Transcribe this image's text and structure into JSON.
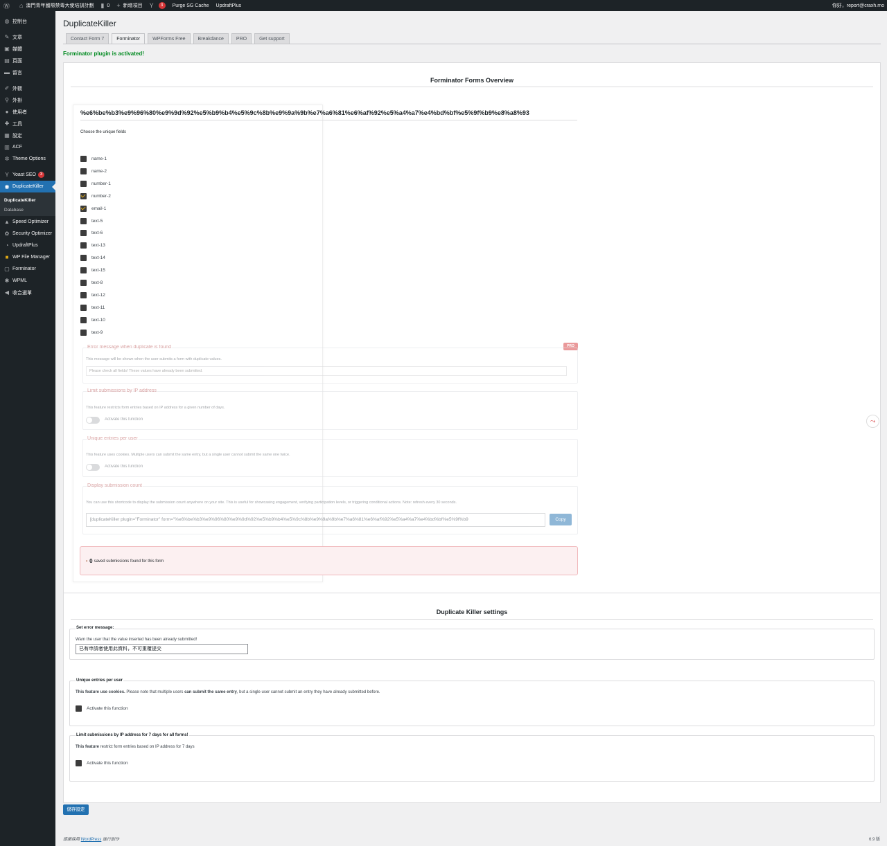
{
  "adminbar": {
    "site": "澳門青年國際禁毒大使培訓計劃",
    "comments": "0",
    "new": "新增項目",
    "yoast_count": "3",
    "purge": "Purge SG Cache",
    "updraft": "UpdraftPlus",
    "greeting": "你好，report@craxh.mo"
  },
  "menu": {
    "dashboard": "控制台",
    "posts": "文章",
    "media": "媒體",
    "pages": "頁面",
    "comments": "留言",
    "appearance": "外觀",
    "plugins": "外掛",
    "users": "使用者",
    "tools": "工具",
    "settings": "設定",
    "acf": "ACF",
    "theme_options": "Theme Options",
    "yoast": "Yoast SEO",
    "yoast_badge": "3",
    "duplicatekiller": "DuplicateKiller",
    "sub_dk": "DuplicateKiller",
    "sub_db": "Database",
    "speed": "Speed Optimizer",
    "security": "Security Optimizer",
    "updraft": "UpdraftPlus",
    "wpfm": "WP File Manager",
    "forminator": "Forminator",
    "wpml": "WPML",
    "collapse": "收合選單"
  },
  "page": {
    "title": "DuplicateKiller",
    "notice": "Forminator plugin is activated!"
  },
  "tabs": [
    "Contact Form 7",
    "Forminator",
    "WPForms Free",
    "Breakdance",
    "PRO",
    "Get support"
  ],
  "overview": {
    "title": "Forminator Forms Overview",
    "form_name": "%e6%be%b3%e9%96%80%e9%9d%92%e5%b9%b4%e5%9c%8b%e9%9a%9b%e7%a6%81%e6%af%92%e5%a4%a7%e4%bd%bf%e5%9f%b9%e8%a8%93",
    "choose_label": "Choose the unique fields",
    "fields": [
      {
        "name": "name-1",
        "checked": false
      },
      {
        "name": "name-2",
        "checked": false
      },
      {
        "name": "number-1",
        "checked": false
      },
      {
        "name": "number-2",
        "checked": true
      },
      {
        "name": "email-1",
        "checked": true
      },
      {
        "name": "text-5",
        "checked": false
      },
      {
        "name": "text-6",
        "checked": false
      },
      {
        "name": "text-13",
        "checked": false
      },
      {
        "name": "text-14",
        "checked": false
      },
      {
        "name": "text-15",
        "checked": false
      },
      {
        "name": "text-8",
        "checked": false
      },
      {
        "name": "text-12",
        "checked": false
      },
      {
        "name": "text-11",
        "checked": false
      },
      {
        "name": "text-10",
        "checked": false
      },
      {
        "name": "text-9",
        "checked": false
      }
    ],
    "pro_badge": "PRO",
    "error_section": {
      "title": "Error message when duplicate is found",
      "desc": "This message will be shown when the user submits a form with duplicate values.",
      "placeholder": "Please check all fields! These values have already been submitted."
    },
    "ip_section": {
      "title": "Limit submissions by IP address",
      "desc": "This feature restricts form entries based on IP address for a given number of days.",
      "toggle": "Activate this function"
    },
    "unique_section": {
      "title": "Unique entries per user",
      "desc": "This feature uses cookies. Multiple users can submit the same entry, but a single user cannot submit the same one twice.",
      "toggle": "Activate this function"
    },
    "count_section": {
      "title": "Display submission count",
      "desc": "You can use this shortcode to display the submission count anywhere on your site. This is useful for showcasing engagement, verifying participation levels, or triggering conditional actions. Note: refresh every 30 seconds.",
      "shortcode": "[duplicateKiller plugin=\"Forminator\" form=\"%e6%be%b3%e9%96%80%e9%9d%92%e5%b9%b4%e5%9c%8b%e9%9a%9b%e7%a6%81%e6%af%92%e5%a4%a7%e4%bd%bf%e5%9f%b9",
      "copy": "Copy"
    },
    "count": {
      "number": "0",
      "text": "saved submissions found for this form"
    }
  },
  "settings": {
    "title": "Duplicate Killer settings",
    "error": {
      "legend": "Set error message:",
      "desc": "Warn the user that the value inserted has been already submitted!",
      "value": "已有申請者使用此資料，不可重覆提交"
    },
    "unique": {
      "legend": "Unique entries per user",
      "desc_b1": "This feature use cookies.",
      "desc_t1": " Please note that multiple users ",
      "desc_b2": "can submit the same entry",
      "desc_t2": ", but a single user cannot submit an entry they have already submitted before.",
      "cb": "Activate this function"
    },
    "ip": {
      "legend": "Limit submissions by IP address for 7 days for all forms!",
      "desc_b": "This feature",
      "desc_t": " restrict form entries based on IP address for 7 days",
      "cb": "Activate this function"
    },
    "save": "儲存設定"
  },
  "footer": {
    "pre": "感謝採用 ",
    "link": "WordPress",
    "post": " 進行創作",
    "version": "6.9 版"
  }
}
